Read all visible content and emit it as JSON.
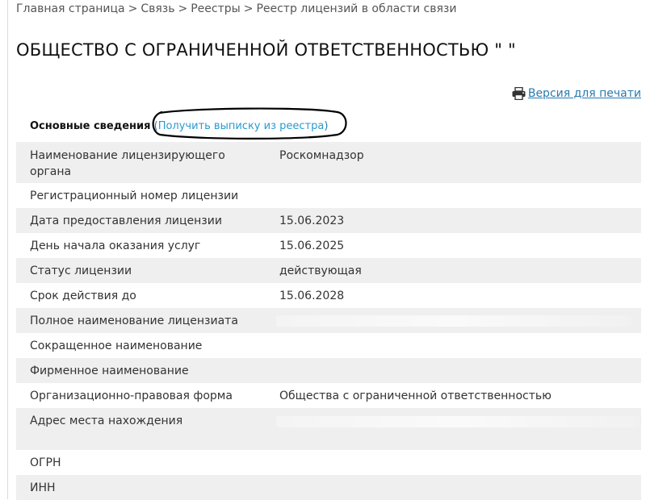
{
  "breadcrumb": {
    "items": [
      "Главная страница",
      "Связь",
      "Реестры",
      "Реестр лицензий в области связи"
    ],
    "separator": ">"
  },
  "page_title": "ОБЩЕСТВО С ОГРАНИЧЕННОЙ ОТВЕТСТВЕННОСТЬЮ \"            \"",
  "print_link": {
    "label": "Версия для печати",
    "icon": "printer-icon"
  },
  "section": {
    "title": "Основные сведения",
    "open_paren": "(",
    "extract_link": "Получить выписку из реестра",
    "close_paren": ")"
  },
  "rows": [
    {
      "label": "Наименование лицензирующего органа",
      "value": "Роскомнадзор"
    },
    {
      "label": "Регистрационный номер лицензии",
      "value": ""
    },
    {
      "label": "Дата предоставления лицензии",
      "value": "15.06.2023"
    },
    {
      "label": "День начала оказания услуг",
      "value": "15.06.2025"
    },
    {
      "label": "Статус лицензии",
      "value": "действующая"
    },
    {
      "label": "Срок действия до",
      "value": "15.06.2028"
    },
    {
      "label": "Полное наименование лицензиата",
      "value": ""
    },
    {
      "label": "Сокращенное наименование",
      "value": ""
    },
    {
      "label": "Фирменное наименование",
      "value": ""
    },
    {
      "label": "Организационно-правовая форма",
      "value": "Общества с ограниченной ответственностью"
    },
    {
      "label": "Адрес места нахождения",
      "value": ""
    },
    {
      "label": "ОГРН",
      "value": ""
    },
    {
      "label": "ИНН",
      "value": ""
    }
  ],
  "colors": {
    "link": "#2a7ab0",
    "row_shade": "#efefef"
  }
}
